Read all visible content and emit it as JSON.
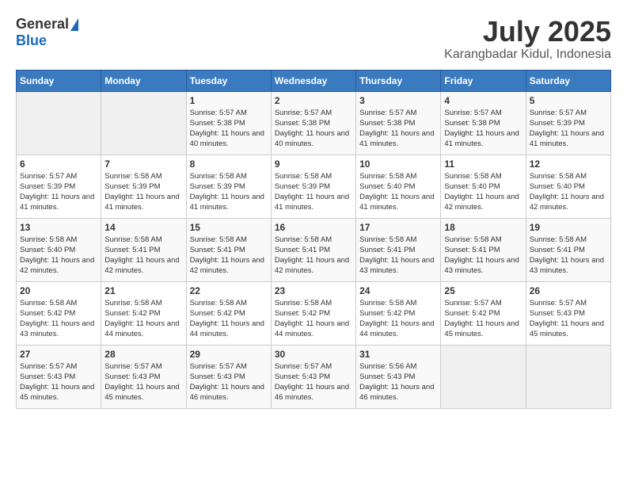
{
  "header": {
    "logo_general": "General",
    "logo_blue": "Blue",
    "month_title": "July 2025",
    "location": "Karangbadar Kidul, Indonesia"
  },
  "calendar": {
    "days_of_week": [
      "Sunday",
      "Monday",
      "Tuesday",
      "Wednesday",
      "Thursday",
      "Friday",
      "Saturday"
    ],
    "weeks": [
      [
        {
          "day": "",
          "info": ""
        },
        {
          "day": "",
          "info": ""
        },
        {
          "day": "1",
          "info": "Sunrise: 5:57 AM\nSunset: 5:38 PM\nDaylight: 11 hours and 40 minutes."
        },
        {
          "day": "2",
          "info": "Sunrise: 5:57 AM\nSunset: 5:38 PM\nDaylight: 11 hours and 40 minutes."
        },
        {
          "day": "3",
          "info": "Sunrise: 5:57 AM\nSunset: 5:38 PM\nDaylight: 11 hours and 41 minutes."
        },
        {
          "day": "4",
          "info": "Sunrise: 5:57 AM\nSunset: 5:38 PM\nDaylight: 11 hours and 41 minutes."
        },
        {
          "day": "5",
          "info": "Sunrise: 5:57 AM\nSunset: 5:39 PM\nDaylight: 11 hours and 41 minutes."
        }
      ],
      [
        {
          "day": "6",
          "info": "Sunrise: 5:57 AM\nSunset: 5:39 PM\nDaylight: 11 hours and 41 minutes."
        },
        {
          "day": "7",
          "info": "Sunrise: 5:58 AM\nSunset: 5:39 PM\nDaylight: 11 hours and 41 minutes."
        },
        {
          "day": "8",
          "info": "Sunrise: 5:58 AM\nSunset: 5:39 PM\nDaylight: 11 hours and 41 minutes."
        },
        {
          "day": "9",
          "info": "Sunrise: 5:58 AM\nSunset: 5:39 PM\nDaylight: 11 hours and 41 minutes."
        },
        {
          "day": "10",
          "info": "Sunrise: 5:58 AM\nSunset: 5:40 PM\nDaylight: 11 hours and 41 minutes."
        },
        {
          "day": "11",
          "info": "Sunrise: 5:58 AM\nSunset: 5:40 PM\nDaylight: 11 hours and 42 minutes."
        },
        {
          "day": "12",
          "info": "Sunrise: 5:58 AM\nSunset: 5:40 PM\nDaylight: 11 hours and 42 minutes."
        }
      ],
      [
        {
          "day": "13",
          "info": "Sunrise: 5:58 AM\nSunset: 5:40 PM\nDaylight: 11 hours and 42 minutes."
        },
        {
          "day": "14",
          "info": "Sunrise: 5:58 AM\nSunset: 5:41 PM\nDaylight: 11 hours and 42 minutes."
        },
        {
          "day": "15",
          "info": "Sunrise: 5:58 AM\nSunset: 5:41 PM\nDaylight: 11 hours and 42 minutes."
        },
        {
          "day": "16",
          "info": "Sunrise: 5:58 AM\nSunset: 5:41 PM\nDaylight: 11 hours and 42 minutes."
        },
        {
          "day": "17",
          "info": "Sunrise: 5:58 AM\nSunset: 5:41 PM\nDaylight: 11 hours and 43 minutes."
        },
        {
          "day": "18",
          "info": "Sunrise: 5:58 AM\nSunset: 5:41 PM\nDaylight: 11 hours and 43 minutes."
        },
        {
          "day": "19",
          "info": "Sunrise: 5:58 AM\nSunset: 5:41 PM\nDaylight: 11 hours and 43 minutes."
        }
      ],
      [
        {
          "day": "20",
          "info": "Sunrise: 5:58 AM\nSunset: 5:42 PM\nDaylight: 11 hours and 43 minutes."
        },
        {
          "day": "21",
          "info": "Sunrise: 5:58 AM\nSunset: 5:42 PM\nDaylight: 11 hours and 44 minutes."
        },
        {
          "day": "22",
          "info": "Sunrise: 5:58 AM\nSunset: 5:42 PM\nDaylight: 11 hours and 44 minutes."
        },
        {
          "day": "23",
          "info": "Sunrise: 5:58 AM\nSunset: 5:42 PM\nDaylight: 11 hours and 44 minutes."
        },
        {
          "day": "24",
          "info": "Sunrise: 5:58 AM\nSunset: 5:42 PM\nDaylight: 11 hours and 44 minutes."
        },
        {
          "day": "25",
          "info": "Sunrise: 5:57 AM\nSunset: 5:42 PM\nDaylight: 11 hours and 45 minutes."
        },
        {
          "day": "26",
          "info": "Sunrise: 5:57 AM\nSunset: 5:43 PM\nDaylight: 11 hours and 45 minutes."
        }
      ],
      [
        {
          "day": "27",
          "info": "Sunrise: 5:57 AM\nSunset: 5:43 PM\nDaylight: 11 hours and 45 minutes."
        },
        {
          "day": "28",
          "info": "Sunrise: 5:57 AM\nSunset: 5:43 PM\nDaylight: 11 hours and 45 minutes."
        },
        {
          "day": "29",
          "info": "Sunrise: 5:57 AM\nSunset: 5:43 PM\nDaylight: 11 hours and 46 minutes."
        },
        {
          "day": "30",
          "info": "Sunrise: 5:57 AM\nSunset: 5:43 PM\nDaylight: 11 hours and 46 minutes."
        },
        {
          "day": "31",
          "info": "Sunrise: 5:56 AM\nSunset: 5:43 PM\nDaylight: 11 hours and 46 minutes."
        },
        {
          "day": "",
          "info": ""
        },
        {
          "day": "",
          "info": ""
        }
      ]
    ]
  }
}
